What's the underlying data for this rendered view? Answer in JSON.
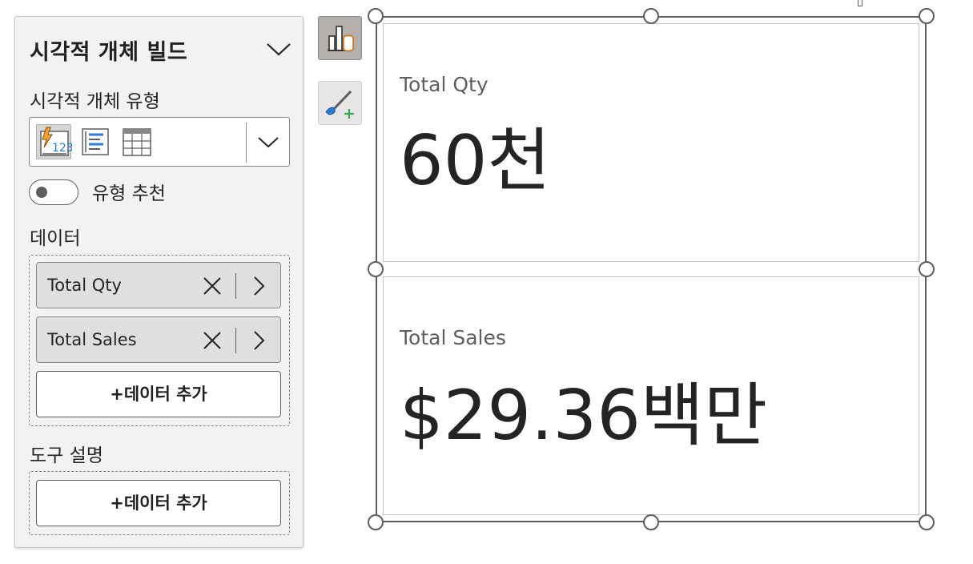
{
  "build_pane": {
    "title": "시각적 개체 빌드",
    "visual_type_label": "시각적 개체 유형",
    "visual_types": [
      {
        "icon": "card-visual-icon",
        "selected": true
      },
      {
        "icon": "multi-row-card-icon",
        "selected": false
      },
      {
        "icon": "table-icon",
        "selected": false
      }
    ],
    "suggest_type_label": "유형 추천",
    "suggest_type_on": false,
    "data_label": "데이터",
    "data_fields": [
      {
        "name": "Total Qty"
      },
      {
        "name": "Total Sales"
      }
    ],
    "add_data_label": "+데이터 추가",
    "tooltips_label": "도구 설명",
    "tooltips_add_label": "+데이터 추가"
  },
  "tools": [
    {
      "icon": "build-visual-icon",
      "active": true
    },
    {
      "icon": "format-visual-icon",
      "active": false
    }
  ],
  "cards": [
    {
      "label": "Total Qty",
      "value": "60천"
    },
    {
      "label": "Total Sales",
      "value": "$29.36백만"
    }
  ],
  "colors": {
    "pane_bg": "#f3f2f1",
    "pill_bg": "#e1dfdd",
    "text": "#252423",
    "accent_orange": "#f2a33a",
    "accent_blue": "#2b7cd3",
    "accent_green": "#33a852"
  }
}
